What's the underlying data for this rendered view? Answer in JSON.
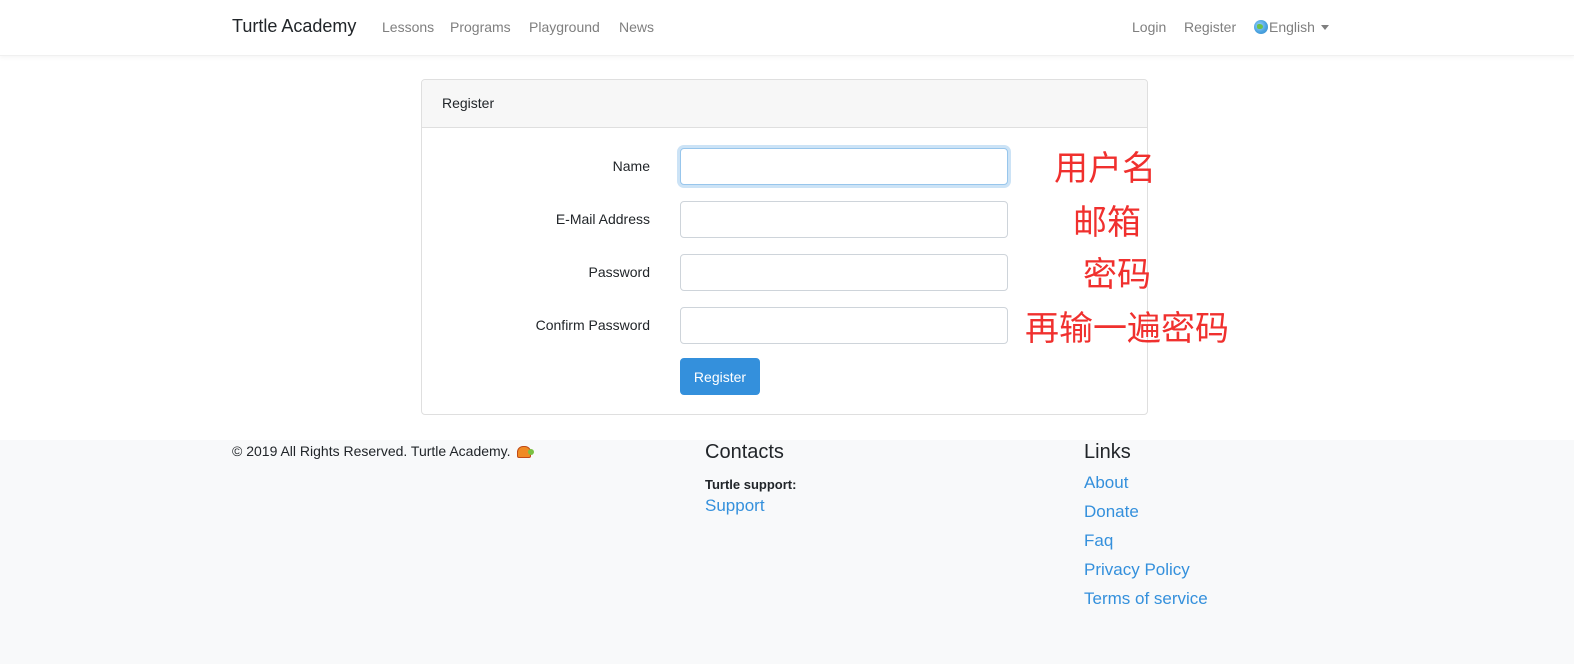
{
  "navbar": {
    "brand": "Turtle Academy",
    "links": [
      "Lessons",
      "Programs",
      "Playground",
      "News"
    ],
    "right_links": [
      "Login",
      "Register"
    ],
    "language": "English"
  },
  "register_card": {
    "header": "Register",
    "fields": {
      "name_label": "Name",
      "email_label": "E-Mail Address",
      "password_label": "Password",
      "confirm_label": "Confirm Password"
    },
    "submit_label": "Register"
  },
  "annotations": {
    "name": "用户名",
    "email": "邮箱",
    "password": "密码",
    "confirm": "再输一遍密码"
  },
  "footer": {
    "copyright": "©  2019 All Rights Reserved. Turtle Academy.",
    "contacts_heading": "Contacts",
    "support_label": "Turtle support:",
    "support_link": "Support",
    "links_heading": "Links",
    "links": [
      "About",
      "Donate",
      "Faq",
      "Privacy Policy",
      "Terms of service"
    ]
  },
  "colors": {
    "primary": "#3490dc",
    "annotation": "#f0302e",
    "footer_bg": "#f8f9fa"
  }
}
